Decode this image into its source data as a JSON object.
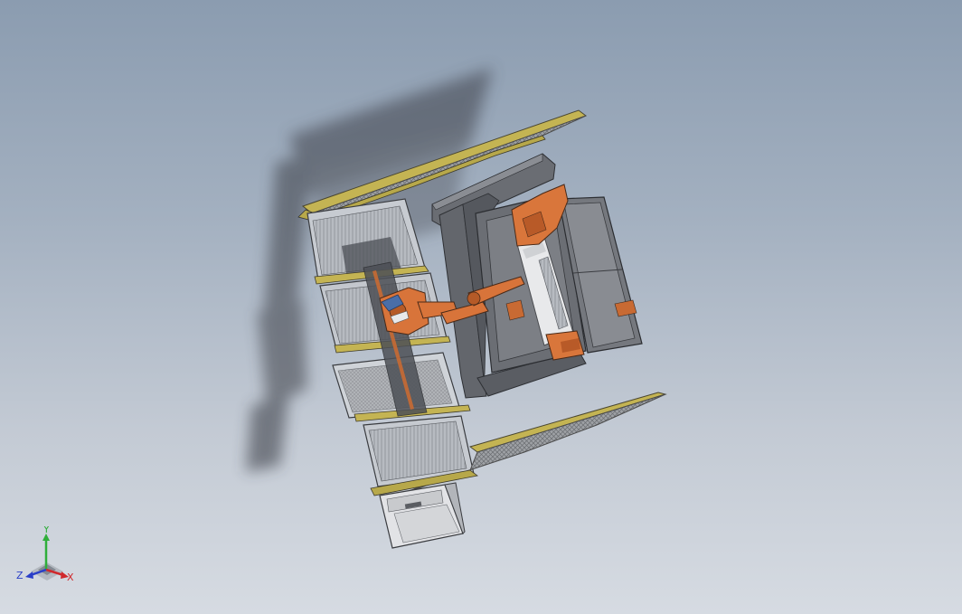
{
  "viewport": {
    "background_top": "#8b9cb0",
    "background_bottom": "#d6dbe2",
    "model_colors": {
      "robot": "#d8743a",
      "frame": "#5d6066",
      "panel_trim": "#b7a84a",
      "mesh": "#8f9296",
      "cabinet": "#e4e4e6"
    }
  },
  "triad": {
    "y_label": "Y",
    "x_label": "X",
    "z_label": "Z",
    "y_color": "#2fae3a",
    "x_color": "#d0282c",
    "z_color": "#2a3fc8"
  }
}
